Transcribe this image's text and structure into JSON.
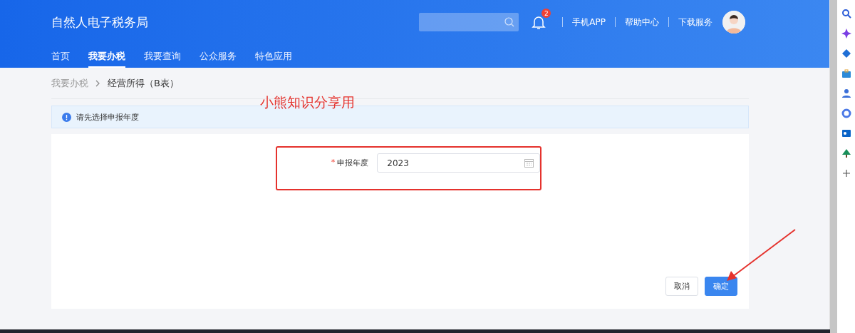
{
  "header": {
    "title": "自然人电子税务局",
    "notification_count": "2",
    "links": [
      "手机APP",
      "帮助中心",
      "下载服务"
    ]
  },
  "nav": [
    {
      "label": "首页",
      "selected": false
    },
    {
      "label": "我要办税",
      "selected": true
    },
    {
      "label": "我要查询",
      "selected": false
    },
    {
      "label": "公众服务",
      "selected": false
    },
    {
      "label": "特色应用",
      "selected": false
    }
  ],
  "breadcrumb": [
    "我要办税",
    "经营所得（B表）"
  ],
  "alert": {
    "text": "请先选择申报年度"
  },
  "form": {
    "label": "申报年度",
    "required_mark": "*",
    "value": "2023"
  },
  "buttons": [
    {
      "label": "取消",
      "kind": "default"
    },
    {
      "label": "确定",
      "kind": "primary"
    }
  ],
  "annotation": {
    "text": "小熊知识分享用"
  }
}
